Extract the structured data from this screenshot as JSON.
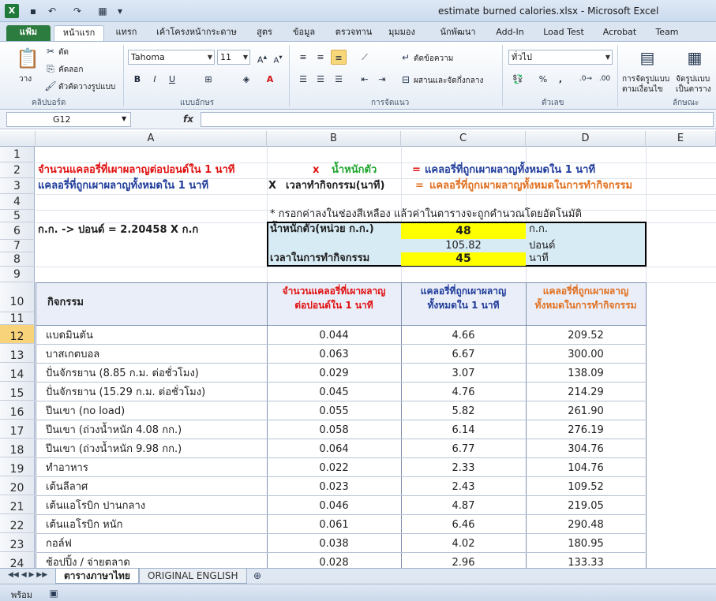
{
  "window": {
    "title": "estimate burned calories.xlsx - Microsoft Excel"
  },
  "tabs": [
    "แฟ้ม",
    "หน้าแรก",
    "แทรก",
    "เค้าโครงหน้ากระดาษ",
    "สูตร",
    "ข้อมูล",
    "ตรวจทาน",
    "มุมมอง",
    "นักพัฒนา",
    "Add-In",
    "Load Test",
    "Acrobat",
    "Team"
  ],
  "ribbon": {
    "paste": "วาง",
    "cut": "ตัด",
    "copy": "คัดลอก",
    "format_painter": "ตัวคัดวางรูปแบบ",
    "clipboard_label": "คลิปบอร์ด",
    "font_name": "Tahoma",
    "font_size": "11",
    "font_label": "แบบอักษร",
    "wrap_text": "ตัดข้อความ",
    "merge_center": "ผสานและจัดกึ่งกลาง",
    "alignment_label": "การจัดแนว",
    "number_format": "ทั่วไป",
    "number_label": "ตัวเลข",
    "conditional_format": "การจัดรูปแบบ",
    "conditional_format_2": "ตามเงื่อนไข",
    "format_table": "จัดรูปแบบ",
    "format_table_2": "เป็นตาราง",
    "styles_label": "ลักษณะ"
  },
  "formula_bar": {
    "name_box": "G12",
    "fx": "fx",
    "formula": ""
  },
  "columns": [
    "A",
    "B",
    "C",
    "D",
    "E"
  ],
  "rows": [
    "1",
    "2",
    "3",
    "4",
    "5",
    "6",
    "7",
    "8",
    "9",
    "10",
    "11",
    "12",
    "13",
    "14",
    "15",
    "16",
    "17",
    "18",
    "19",
    "20",
    "21",
    "22",
    "23",
    "24"
  ],
  "sheet": {
    "r2_a": "จำนวนแคลอรี่ที่เผาผลาญต่อปอนด์ใน 1 นาที",
    "r2_x": "x",
    "r2_c": "น้ำหนักตัว",
    "r2_eq": "=",
    "r2_d": "แคลอรี่ที่ถูกเผาผลาญทั้งหมดใน 1 นาที",
    "r3_a": "แคลอรี่ที่ถูกเผาผลาญทั้งหมดใน 1 นาที",
    "r3_x": "X",
    "r3_c": "เวลาทำกิจกรรม(นาที)",
    "r3_eq": "=",
    "r3_d": "แคลอรี่ที่ถูกเผาผลาญทั้งหมดในการทำกิจกรรม",
    "r5_note": "* กรอกค่าลงในช่องสีเหลือง แล้วค่าในตารางจะถูกคำนวณโดยอัตโนมัติ",
    "r6_a": "ก.ก. -> ปอนด์  = 2.20458 X ก.ก",
    "r6_b": "น้ำหนักตัว(หน่วย ก.ก.)",
    "r6_c": "48",
    "r6_d": "ก.ก.",
    "r7_c": "105.82",
    "r7_d": "ปอนด์",
    "r8_b": "เวลาในการทำกิจกรรม",
    "r8_c": "45",
    "r8_d": "นาที",
    "hdr_a": "กิจกรรม",
    "hdr_b1": "จำนวนแคลอรี่ที่เผาผลาญ",
    "hdr_b2": "ต่อปอนด์ใน 1 นาที",
    "hdr_c1": "แคลอรี่ที่ถูกเผาผลาญ",
    "hdr_c2": "ทั้งหมดใน 1 นาที",
    "hdr_d1": "แคลอรี่ที่ถูกเผาผลาญ",
    "hdr_d2": "ทั้งหมดในการทำกิจกรรม"
  },
  "activities": [
    {
      "name": "แบดมินตัน",
      "per_lb": "0.044",
      "per_min": "4.66",
      "total": "209.52"
    },
    {
      "name": "บาสเกตบอล",
      "per_lb": "0.063",
      "per_min": "6.67",
      "total": "300.00"
    },
    {
      "name": "ปั่นจักรยาน  (8.85 ก.ม. ต่อชั่วโมง)",
      "per_lb": "0.029",
      "per_min": "3.07",
      "total": "138.09"
    },
    {
      "name": "ปั่นจักรยาน  (15.29 ก.ม. ต่อชั่วโมง)",
      "per_lb": "0.045",
      "per_min": "4.76",
      "total": "214.29"
    },
    {
      "name": "ปีนเขา  (no load)",
      "per_lb": "0.055",
      "per_min": "5.82",
      "total": "261.90"
    },
    {
      "name": "ปีนเขา  (ถ่วงน้ำหนัก  4.08 กก.)",
      "per_lb": "0.058",
      "per_min": "6.14",
      "total": "276.19"
    },
    {
      "name": "ปีนเขา  (ถ่วงน้ำหนัก  9.98 กก.)",
      "per_lb": "0.064",
      "per_min": "6.77",
      "total": "304.76"
    },
    {
      "name": "ทำอาหาร",
      "per_lb": "0.022",
      "per_min": "2.33",
      "total": "104.76"
    },
    {
      "name": "เต้นลีลาศ",
      "per_lb": "0.023",
      "per_min": "2.43",
      "total": "109.52"
    },
    {
      "name": "เต้นแอโรบิก      ปานกลาง",
      "per_lb": "0.046",
      "per_min": "4.87",
      "total": "219.05"
    },
    {
      "name": "เต้นแอโรบิก      หนัก",
      "per_lb": "0.061",
      "per_min": "6.46",
      "total": "290.48"
    },
    {
      "name": "กอล์ฟ",
      "per_lb": "0.038",
      "per_min": "4.02",
      "total": "180.95"
    },
    {
      "name": "ช้อปปิ้ง  / จ่ายตลาด",
      "per_lb": "0.028",
      "per_min": "2.96",
      "total": "133.33"
    }
  ],
  "sheet_tabs": [
    "ตารางภาษาไทย",
    "ORIGINAL ENGLISH"
  ],
  "status": "พร้อม"
}
